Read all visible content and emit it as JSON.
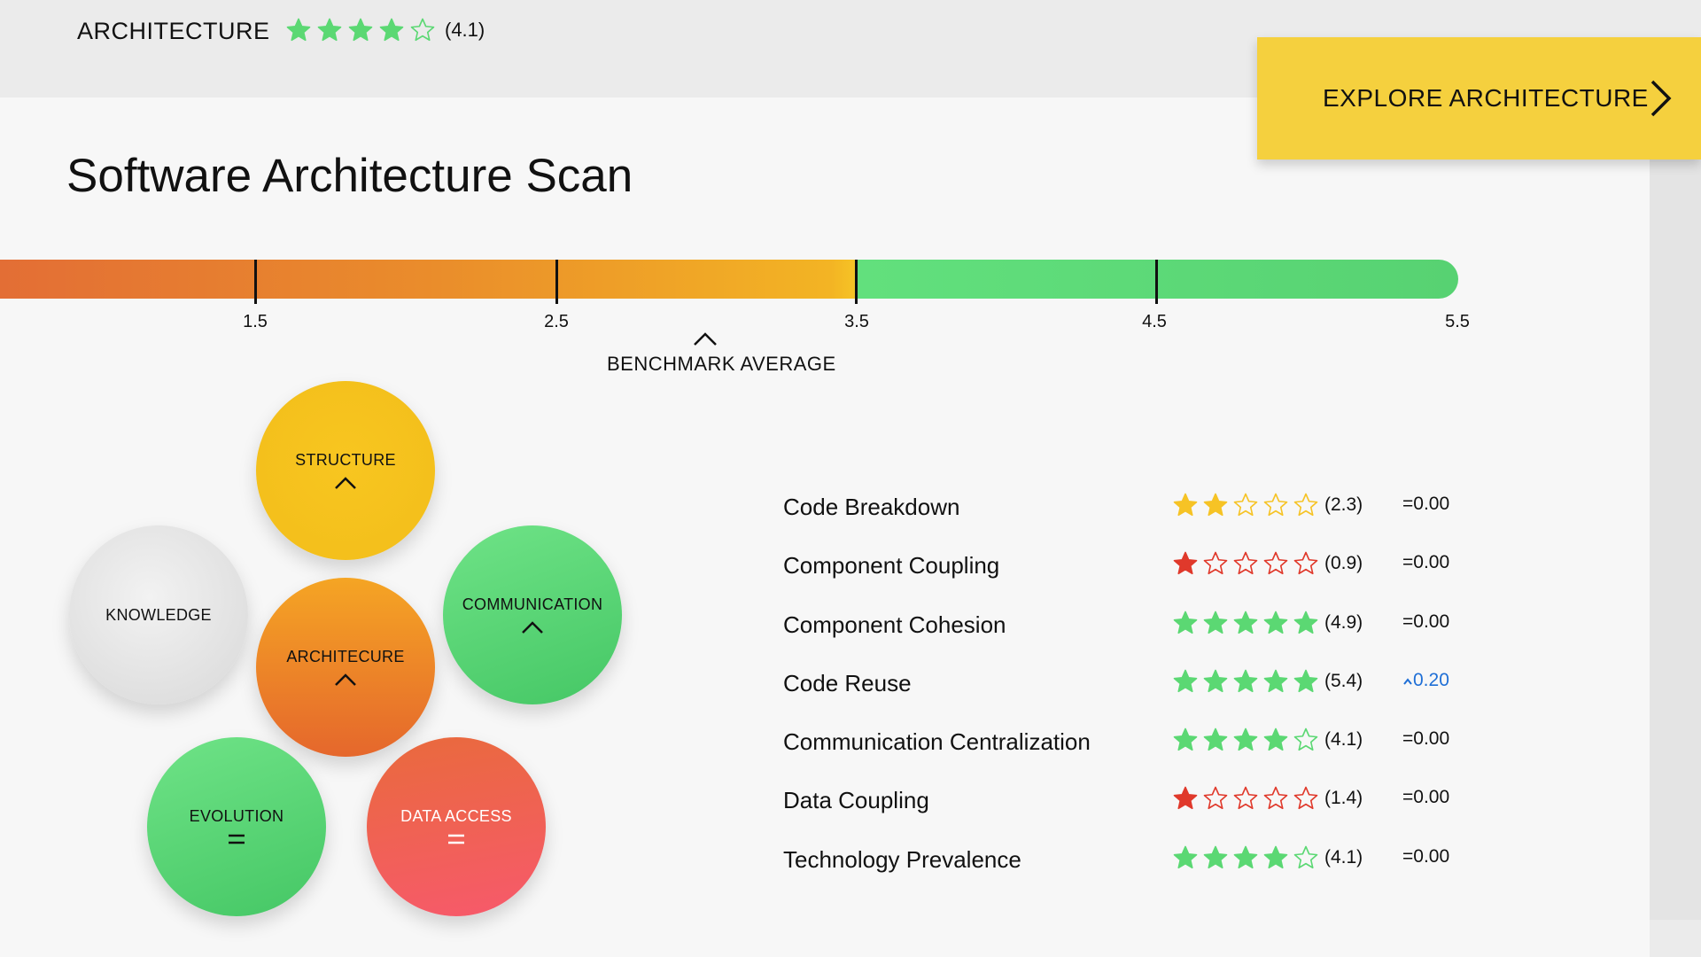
{
  "header": {
    "title": "ARCHITECTURE",
    "rating": 4.1,
    "rating_text": "(4.1)",
    "explore_button": "EXPLORE ARCHITECTURE"
  },
  "page": {
    "title": "Software Architecture Scan"
  },
  "benchmark_scale": {
    "ticks": [
      "1.5",
      "2.5",
      "3.5",
      "4.5",
      "5.5"
    ],
    "benchmark_label": "BENCHMARK AVERAGE"
  },
  "categories": [
    {
      "label": "STRUCTURE",
      "indicator": "up"
    },
    {
      "label": "KNOWLEDGE",
      "indicator": "none"
    },
    {
      "label": "COMMUNICATION",
      "indicator": "up"
    },
    {
      "label": "ARCHITECURE",
      "indicator": "up"
    },
    {
      "label": "EVOLUTION",
      "indicator": "equal"
    },
    {
      "label": "DATA ACCESS",
      "indicator": "equal"
    }
  ],
  "metrics": [
    {
      "name": "Code Breakdown",
      "rating": 2.3,
      "score_text": "(2.3)",
      "delta": "=0.00",
      "star_color": "#f6c325"
    },
    {
      "name": "Component Coupling",
      "rating": 0.9,
      "score_text": "(0.9)",
      "delta": "=0.00",
      "star_color": "#e0392b"
    },
    {
      "name": "Component Cohesion",
      "rating": 4.9,
      "score_text": "(4.9)",
      "delta": "=0.00",
      "star_color": "#5bd873"
    },
    {
      "name": "Code Reuse",
      "rating": 5.4,
      "score_text": "(5.4)",
      "delta": "0.20",
      "star_color": "#5bd873"
    },
    {
      "name": "Communication Centralization",
      "rating": 4.1,
      "score_text": "(4.1)",
      "delta": "=0.00",
      "star_color": "#5bd873"
    },
    {
      "name": "Data Coupling",
      "rating": 1.4,
      "score_text": "(1.4)",
      "delta": "=0.00",
      "star_color": "#e0392b"
    },
    {
      "name": "Technology Prevalence",
      "rating": 4.1,
      "score_text": "(4.1)",
      "delta": "=0.00",
      "star_color": "#5bd873"
    }
  ],
  "colors": {
    "accent_yellow": "#f5d03e",
    "good_green": "#5bd873",
    "warn_yellow": "#f6c325",
    "bad_red": "#e0392b",
    "delta_blue": "#1f6fd6"
  }
}
